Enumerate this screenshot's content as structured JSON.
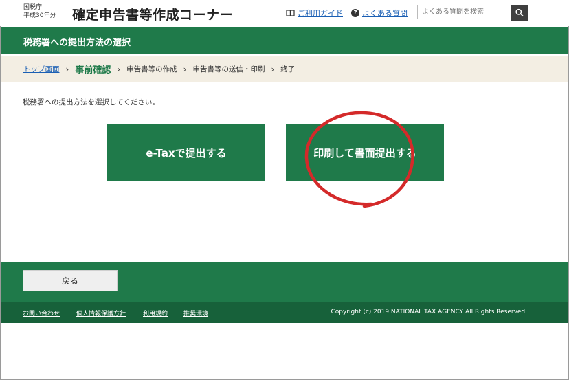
{
  "header": {
    "agency_line1": "国税庁",
    "agency_line2": "平成30年分",
    "app_title": "確定申告書等作成コーナー",
    "guide_label": "ご利用ガイド",
    "faq_label": "よくある質問",
    "search_placeholder": "よくある質問を検索",
    "icons": {
      "guide": "book-icon",
      "faq": "question-icon",
      "search": "search-icon"
    }
  },
  "title_bar": {
    "title": "税務署への提出方法の選択"
  },
  "breadcrumb": [
    {
      "label": "トップ画面",
      "link": true
    },
    {
      "label": "事前確認",
      "current": true
    },
    {
      "label": "申告書等の作成"
    },
    {
      "label": "申告書等の送信・印刷"
    },
    {
      "label": "終了"
    }
  ],
  "main": {
    "instruction": "税務署への提出方法を選択してください。",
    "etax_button": "e-Taxで提出する",
    "print_button": "印刷して書面提出する"
  },
  "bottom": {
    "back_button": "戻る"
  },
  "footer": {
    "links": [
      "お問い合わせ",
      "個人情報保護方針",
      "利用規約",
      "推奨環境"
    ],
    "copyright": "Copyright (c) 2019 NATIONAL TAX AGENCY All Rights Reserved."
  },
  "colors": {
    "brand_green": "#1f7a4a",
    "footer_green": "#17613a",
    "breadcrumb_bg": "#f3eee3",
    "annotation_red": "#d42a2a",
    "link_blue": "#1a5fb4"
  }
}
